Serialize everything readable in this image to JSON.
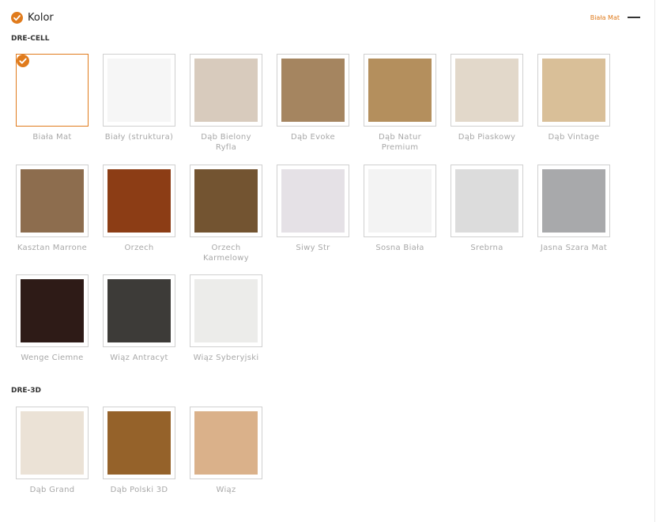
{
  "header": {
    "title": "Kolor",
    "selected_value": "Biała Mat"
  },
  "groups": [
    {
      "label": "DRE-CELL",
      "swatches": [
        {
          "name": "Biała Mat",
          "color": "#ffffff",
          "selected": true
        },
        {
          "name": "Biały (struktura)",
          "color": "#f6f6f6",
          "selected": false
        },
        {
          "name": "Dąb Bielony Ryfla",
          "color": "#d8cbbd",
          "selected": false
        },
        {
          "name": "Dąb Evoke",
          "color": "#a58560",
          "selected": false
        },
        {
          "name": "Dąb Natur Premium",
          "color": "#b48f5d",
          "selected": false
        },
        {
          "name": "Dąb Piaskowy",
          "color": "#e2d8ca",
          "selected": false
        },
        {
          "name": "Dąb Vintage",
          "color": "#d9bf98",
          "selected": false
        },
        {
          "name": "Kasztan Marrone",
          "color": "#8d6d4e",
          "selected": false
        },
        {
          "name": "Orzech",
          "color": "#8c3d15",
          "selected": false
        },
        {
          "name": "Orzech Karmelowy",
          "color": "#735431",
          "selected": false
        },
        {
          "name": "Siwy Str",
          "color": "#e5e1e6",
          "selected": false
        },
        {
          "name": "Sosna Biała",
          "color": "#f3f3f3",
          "selected": false
        },
        {
          "name": "Srebrna",
          "color": "#dcdcdc",
          "selected": false
        },
        {
          "name": "Jasna Szara Mat",
          "color": "#a8a9ab",
          "selected": false
        },
        {
          "name": "Wenge Ciemne",
          "color": "#2e1b17",
          "selected": false
        },
        {
          "name": "Wiąz Antracyt",
          "color": "#3d3b38",
          "selected": false
        },
        {
          "name": "Wiąz Syberyjski",
          "color": "#ececea",
          "selected": false
        }
      ]
    },
    {
      "label": "DRE-3D",
      "swatches": [
        {
          "name": "Dąb Grand",
          "color": "#ebe2d6",
          "selected": false
        },
        {
          "name": "Dąb Polski 3D",
          "color": "#95622a",
          "selected": false
        },
        {
          "name": "Wiąz",
          "color": "#dab18a",
          "selected": false
        }
      ]
    }
  ],
  "icons": {
    "header_check": "check-circle-icon",
    "selected_check": "check-circle-icon",
    "collapse": "minus-icon"
  },
  "colors": {
    "accent": "#e07b1c",
    "label": "#a8a8a8",
    "border": "#d0d0d0"
  }
}
